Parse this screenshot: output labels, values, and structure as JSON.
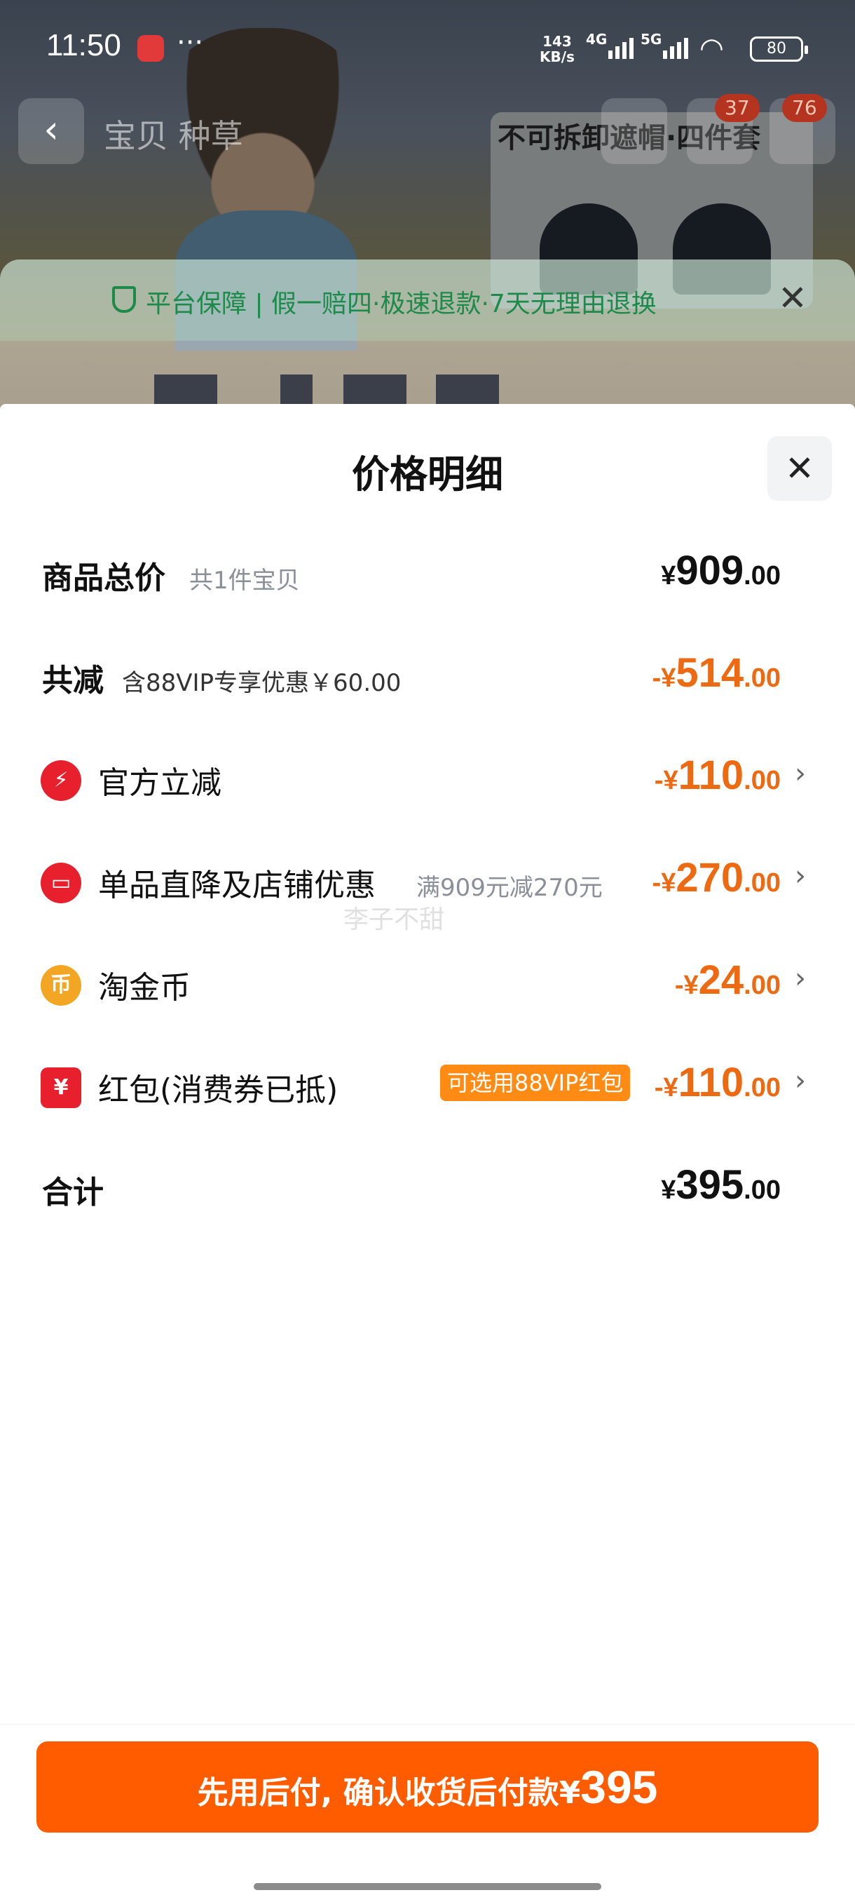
{
  "status_bar": {
    "time": "11:50",
    "more": "···",
    "net_speed_value": "143",
    "net_speed_unit": "KB/s",
    "sim1_label": "4G",
    "sim2_label": "5G",
    "battery": "80"
  },
  "nav": {
    "back_icon": "chevron-left-icon",
    "tabs_text": "宝贝  种草",
    "title": "不可拆卸遮帽·四件套",
    "badge_1": "37",
    "badge_2": "76"
  },
  "guarantee": {
    "text": "平台保障 | 假一赔四·极速退款·7天无理由退换",
    "close": "✕"
  },
  "price_sheet": {
    "title": "价格明细",
    "close": "✕",
    "rows": {
      "subtotal": {
        "label": "商品总价",
        "note": "共1件宝贝",
        "currency": "¥",
        "int": "909",
        "dec": ".00"
      },
      "discount_total": {
        "label": "共减",
        "note": "含88VIP专享优惠￥60.00",
        "prefix": "-¥",
        "int": "514",
        "dec": ".00"
      },
      "official": {
        "icon": "lightning-icon",
        "label": "官方立减",
        "prefix": "-¥",
        "int": "110",
        "dec": ".00"
      },
      "store": {
        "icon": "shop-icon",
        "label": "单品直降及店铺优惠",
        "note": "满909元减270元",
        "prefix": "-¥",
        "int": "270",
        "dec": ".00"
      },
      "coins": {
        "icon": "coin-icon",
        "label": "淘金币",
        "prefix": "-¥",
        "int": "24",
        "dec": ".00"
      },
      "red_packet": {
        "icon": "red-packet-icon",
        "label": "红包(消费券已抵)",
        "tag": "可选用88VIP红包",
        "prefix": "-¥",
        "int": "110",
        "dec": ".00"
      },
      "total": {
        "label": "合计",
        "currency": "¥",
        "int": "395",
        "dec": ".00"
      }
    },
    "watermark": "李子不甜"
  },
  "pay_button": {
    "label": "先用后付, 确认收货后付款",
    "currency": "¥",
    "amount": "395"
  },
  "colors": {
    "accent_orange": "#ff5c00",
    "discount_orange": "#ee6a12",
    "guarantee_green": "#1e8a4a",
    "icon_red": "#e8202e",
    "coin_gold": "#f2a623"
  }
}
